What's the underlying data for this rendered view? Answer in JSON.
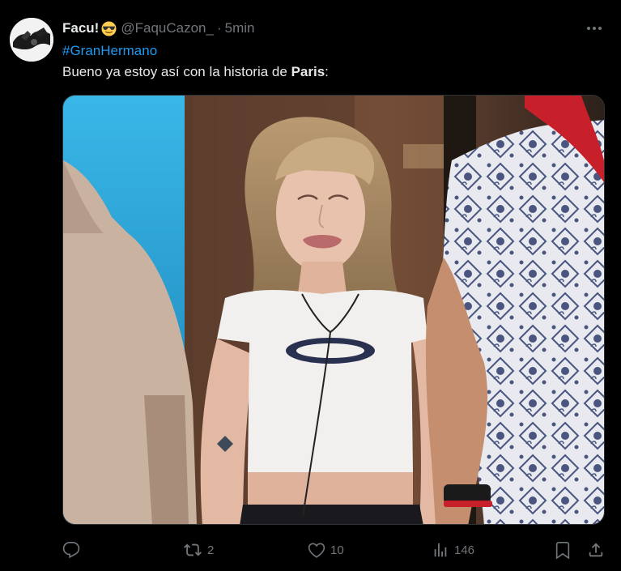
{
  "tweet": {
    "display_name": "Facu!",
    "emoji": "😎",
    "handle": "@FaquCazon_",
    "separator": "·",
    "timestamp": "5min",
    "hashtag": "#GranHermano",
    "text_before": "Bueno ya estoy así con la historia de ",
    "text_bold": "Paris",
    "text_after": ":",
    "media_icon": "photo"
  },
  "actions": {
    "reply": {
      "icon": "reply-icon",
      "count": ""
    },
    "retweet": {
      "icon": "retweet-icon",
      "count": "2"
    },
    "like": {
      "icon": "heart-icon",
      "count": "10"
    },
    "views": {
      "icon": "views-icon",
      "count": "146"
    },
    "bookmark": {
      "icon": "bookmark-icon"
    },
    "share": {
      "icon": "share-icon"
    }
  },
  "colors": {
    "background": "#000000",
    "text": "#e7e9ea",
    "muted": "#71767b",
    "link": "#1d9bf0"
  }
}
